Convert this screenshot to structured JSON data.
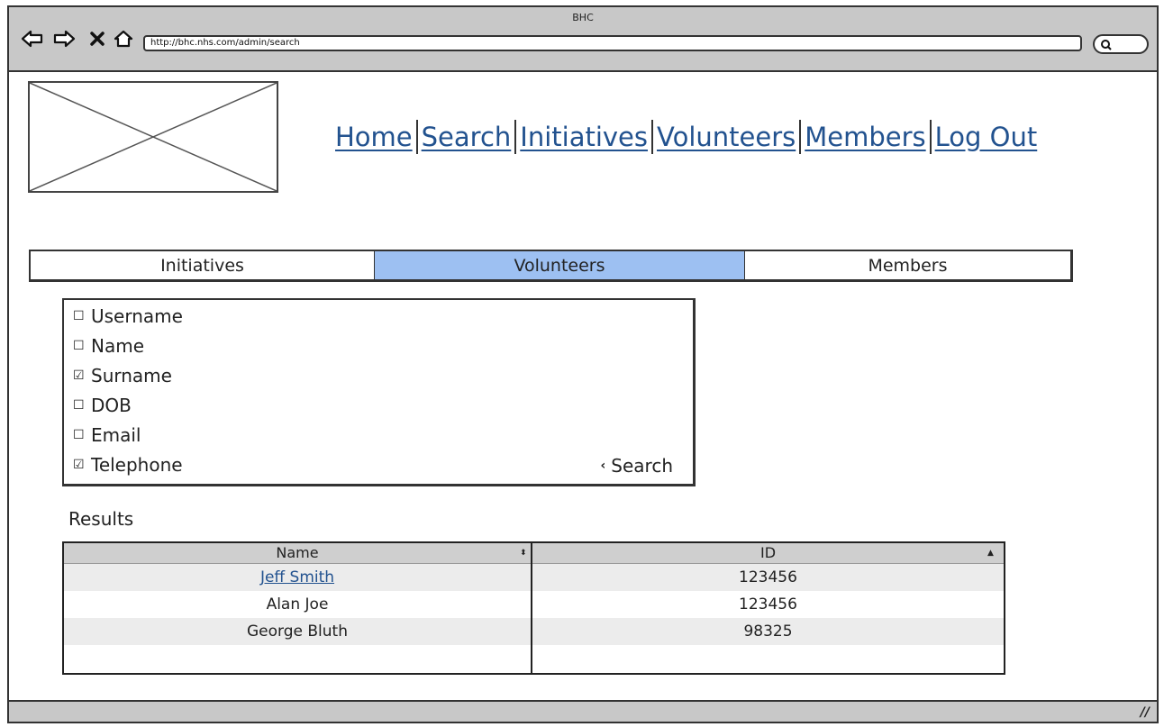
{
  "browser": {
    "title": "BHC",
    "url": "http://bhc.nhs.com/admin/search",
    "controls": [
      "back-arrow-icon",
      "forward-arrow-icon",
      "stop-x-icon",
      "home-icon"
    ]
  },
  "nav": {
    "home": "Home",
    "search": "Search",
    "initiatives": "Initiatives",
    "volunteers": "Volunteers",
    "members": "Members",
    "logout": "Log Out"
  },
  "tabs": [
    {
      "label": "Initiatives",
      "active": false
    },
    {
      "label": "Volunteers",
      "active": true
    },
    {
      "label": "Members",
      "active": false
    }
  ],
  "filters": [
    {
      "label": "Username",
      "checked": false
    },
    {
      "label": "Name",
      "checked": false
    },
    {
      "label": "Surname",
      "checked": true
    },
    {
      "label": "DOB",
      "checked": false
    },
    {
      "label": "Email",
      "checked": false
    },
    {
      "label": "Telephone",
      "checked": true
    }
  ],
  "search_button": {
    "label": "Search"
  },
  "results": {
    "label": "Results",
    "columns": [
      {
        "label": "Name",
        "sort": "both"
      },
      {
        "label": "ID",
        "sort": "ascending"
      }
    ],
    "rows": [
      {
        "name": "Jeff Smith",
        "id": "123456",
        "link": true
      },
      {
        "name": "Alan Joe",
        "id": "123456",
        "link": false
      },
      {
        "name": "George Bluth",
        "id": "98325",
        "link": false
      }
    ]
  },
  "colors": {
    "accent_tab": "#9dc0f2",
    "link": "#22528f",
    "chrome": "#c8c8c8"
  }
}
